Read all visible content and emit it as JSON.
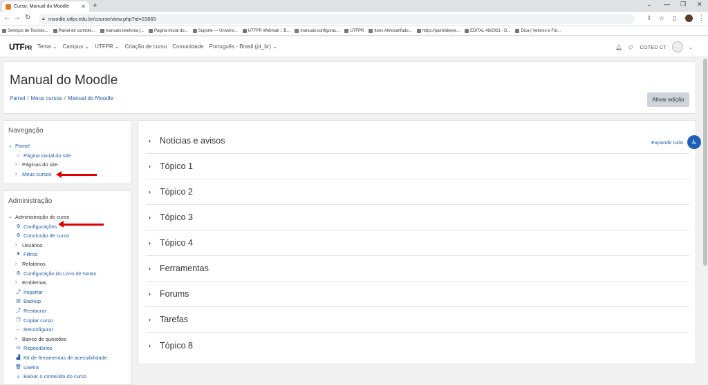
{
  "browser": {
    "tab_title": "Curso: Manual do Moodle",
    "url": "moodle.utfpr.edu.br/course/view.php?id=23665",
    "bookmarks": [
      "Serviços de Tecnolo...",
      "Painel de controle...",
      "manuais:telefonia [...",
      "Página inicial do...",
      "Suporte — Universi...",
      "UTFPR Webmail :: B...",
      "manuais:configurac...",
      "UTFPR",
      "Itens Almoxarifado...",
      "https://paineldepre...",
      "EDITAL 49/2021 - D...",
      "Dica | Vetores e Fot..."
    ]
  },
  "moodle_nav": {
    "logo": "UTF",
    "logo_suffix": "PR",
    "items": [
      "Tema ⌄",
      "Campus ⌄",
      "UTFPR ⌄",
      "Criação de curso",
      "Comunidade",
      "Português - Brasil (pt_br) ⌄"
    ],
    "user": "COTED CT"
  },
  "header": {
    "title": "Manual do Moodle",
    "breadcrumb": [
      "Painel",
      "Meus cursos",
      "Manual do Moodle"
    ],
    "edit_button": "Ativar edição"
  },
  "navigation": {
    "title": "Navegação",
    "root": "Painel",
    "items": [
      {
        "label": "Página inicial do site",
        "icon": "home-icon"
      },
      {
        "label": "Páginas do site",
        "icon": "chevron-right-icon"
      },
      {
        "label": "Meus cursos",
        "icon": "chevron-right-icon"
      }
    ]
  },
  "administration": {
    "title": "Administração",
    "root": "Administração do curso",
    "items": [
      {
        "label": "Configurações",
        "icon": "gear-icon"
      },
      {
        "label": "Conclusão de curso",
        "icon": "gear-icon"
      },
      {
        "label": "Usuários",
        "icon": "chevron-right-icon"
      },
      {
        "label": "Filtros",
        "icon": "filter-icon"
      },
      {
        "label": "Relatórios",
        "icon": "chevron-right-icon"
      },
      {
        "label": "Configuração do Livro de Notas",
        "icon": "gear-icon"
      },
      {
        "label": "Emblemas",
        "icon": "chevron-right-icon"
      },
      {
        "label": "Importar",
        "icon": "import-icon"
      },
      {
        "label": "Backup",
        "icon": "backup-icon"
      },
      {
        "label": "Restaurar",
        "icon": "restore-icon"
      },
      {
        "label": "Copiar curso",
        "icon": "copy-icon"
      },
      {
        "label": "Reconfigurar",
        "icon": "reset-icon"
      },
      {
        "label": "Banco de questões",
        "icon": "chevron-right-icon"
      },
      {
        "label": "Repositórios",
        "icon": "repository-icon"
      },
      {
        "label": "Kit de ferramentas de acessibilidade",
        "icon": "accessibility-chart-icon"
      },
      {
        "label": "Lixeira",
        "icon": "trash-icon"
      },
      {
        "label": "Baixar o conteúdo do curso",
        "icon": "download-icon"
      }
    ]
  },
  "course": {
    "expand_all": "Expandir tudo",
    "sections": [
      "Notícias e avisos",
      "Tópico 1",
      "Tópico 2",
      "Tópico 3",
      "Tópico 4",
      "Ferramentas",
      "Forums",
      "Tarefas",
      "Tópico 8"
    ]
  }
}
